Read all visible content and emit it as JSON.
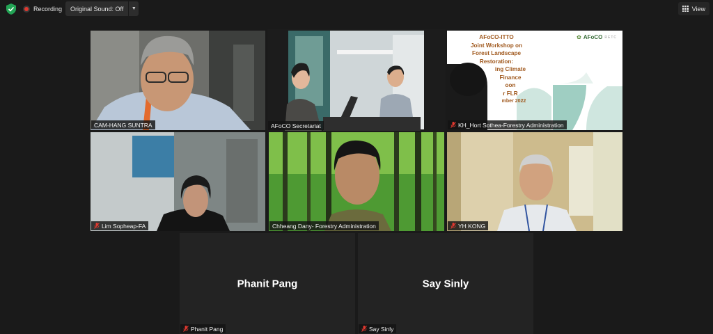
{
  "topbar": {
    "recording_label": "Recording",
    "sound_label": "Original Sound: Off",
    "view_label": "View"
  },
  "tiles": {
    "t1": {
      "name": "CAM-HANG SUNTRA"
    },
    "t2": {
      "name": "AFoCO Secretariat"
    },
    "t3": {
      "name": "KH_Hort Sothea-Forestry Administration"
    },
    "t4": {
      "name": "Lim Sopheap-FA"
    },
    "t5": {
      "name": "Chheang Dany- Forestry Administration"
    },
    "t6": {
      "name": "YH KONG"
    },
    "t7": {
      "name": "Phanit Pang",
      "display": "Phanit Pang"
    },
    "t8": {
      "name": "Say Sinly",
      "display": "Say Sinly"
    }
  },
  "slide": {
    "line1": "AFoCO-ITTO",
    "line2": "Joint Workshop on",
    "line3": "Forest Landscape",
    "line4": "Restoration:",
    "line5": "ing Climate",
    "line6": "Finance",
    "line7": "oon",
    "line8": "r FLR",
    "line9": "mber 2022",
    "logo": "AFoCO",
    "logo_sub": "RETC"
  },
  "colors": {
    "active_border": "#c9e066",
    "muted_mic": "#e0382f",
    "background": "#1a1a1a"
  }
}
